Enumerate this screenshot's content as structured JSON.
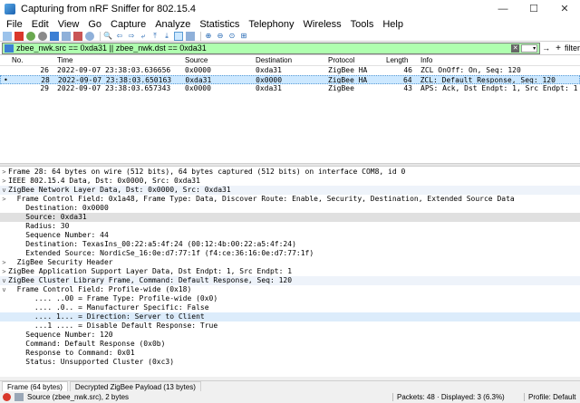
{
  "window": {
    "title": "Capturing from nRF Sniffer for 802.15.4",
    "minimize": "—",
    "maximize": "☐",
    "close": "✕"
  },
  "menu": [
    "File",
    "Edit",
    "View",
    "Go",
    "Capture",
    "Analyze",
    "Statistics",
    "Telephony",
    "Wireless",
    "Tools",
    "Help"
  ],
  "toolbar": {
    "icons": [
      "shark-fin-icon",
      "stop-icon",
      "restart-icon",
      "options-icon",
      "open-icon",
      "save-icon",
      "close-file-icon",
      "reload-icon",
      "find-icon",
      "back-icon",
      "forward-icon",
      "jump-icon",
      "first-icon",
      "last-icon",
      "autoscroll-icon",
      "colorize-icon",
      "zoom-in-icon",
      "zoom-out-icon",
      "zoom-reset-icon",
      "resize-columns-icon"
    ]
  },
  "filter": {
    "value": "zbee_nwk.src == 0xda31 || zbee_nwk.dst == 0xda31",
    "apply_arrow": "→",
    "plus": "+",
    "label": "filter"
  },
  "packet_list": {
    "columns": [
      "No.",
      "Time",
      "Source",
      "Destination",
      "Protocol",
      "Length",
      "Info"
    ],
    "rows": [
      {
        "mark": "",
        "no": "26",
        "time": "2022-09-07 23:38:03.636656",
        "src": "0x0000",
        "dst": "0xda31",
        "proto": "ZigBee HA",
        "len": "46",
        "info": "ZCL OnOff: On, Seq: 120"
      },
      {
        "mark": "•",
        "no": "28",
        "time": "2022-09-07 23:38:03.650163",
        "src": "0xda31",
        "dst": "0x0000",
        "proto": "ZigBee HA",
        "len": "64",
        "info": "ZCL: Default Response, Seq: 120"
      },
      {
        "mark": "",
        "no": "29",
        "time": "2022-09-07 23:38:03.657343",
        "src": "0x0000",
        "dst": "0xda31",
        "proto": "ZigBee",
        "len": "43",
        "info": "APS: Ack, Dst Endpt: 1, Src Endpt: 1"
      }
    ]
  },
  "details": [
    {
      "arrow": ">",
      "text": "Frame 28: 64 bytes on wire (512 bits), 64 bytes captured (512 bits) on interface COM8, id 0"
    },
    {
      "arrow": ">",
      "text": "IEEE 802.15.4 Data, Dst: 0x0000, Src: 0xda31"
    },
    {
      "arrow": "v",
      "text": "ZigBee Network Layer Data, Dst: 0x0000, Src: 0xda31"
    },
    {
      "arrow": ">",
      "text": "  Frame Control Field: 0x1a48, Frame Type: Data, Discover Route: Enable, Security, Destination, Extended Source Data"
    },
    {
      "arrow": "",
      "text": "    Destination: 0x0000"
    },
    {
      "arrow": "",
      "text": "    Source: 0xda31"
    },
    {
      "arrow": "",
      "text": "    Radius: 30"
    },
    {
      "arrow": "",
      "text": "    Sequence Number: 44"
    },
    {
      "arrow": "",
      "text": "    Destination: TexasIns_00:22:a5:4f:24 (00:12:4b:00:22:a5:4f:24)"
    },
    {
      "arrow": "",
      "text": "    Extended Source: NordicSe_16:0e:d7:77:1f (f4:ce:36:16:0e:d7:77:1f)"
    },
    {
      "arrow": ">",
      "text": "  ZigBee Security Header"
    },
    {
      "arrow": ">",
      "text": "ZigBee Application Support Layer Data, Dst Endpt: 1, Src Endpt: 1"
    },
    {
      "arrow": "v",
      "text": "ZigBee Cluster Library Frame, Command: Default Response, Seq: 120"
    },
    {
      "arrow": "v",
      "text": "  Frame Control Field: Profile-wide (0x18)"
    },
    {
      "arrow": "",
      "text": "      .... ..00 = Frame Type: Profile-wide (0x0)"
    },
    {
      "arrow": "",
      "text": "      .... .0.. = Manufacturer Specific: False"
    },
    {
      "arrow": "",
      "text": "      .... 1... = Direction: Server to Client"
    },
    {
      "arrow": "",
      "text": "      ...1 .... = Disable Default Response: True"
    },
    {
      "arrow": "",
      "text": "    Sequence Number: 120"
    },
    {
      "arrow": "",
      "text": "    Command: Default Response (0x0b)"
    },
    {
      "arrow": "",
      "text": "    Response to Command: 0x01"
    },
    {
      "arrow": "",
      "text": "    Status: Unsupported Cluster (0xc3)"
    }
  ],
  "bottom_tabs": [
    "Frame (64 bytes)",
    "Decrypted ZigBee Payload (13 bytes)"
  ],
  "status": {
    "field": "Source (zbee_nwk.src), 2 bytes",
    "packets": "Packets: 48 · Displayed: 3 (6.3%)",
    "profile": "Profile: Default"
  },
  "colors": {
    "filter_bg": "#afffaf",
    "selected_row": "#cce8ff",
    "recording_dot": "#d9382c"
  }
}
